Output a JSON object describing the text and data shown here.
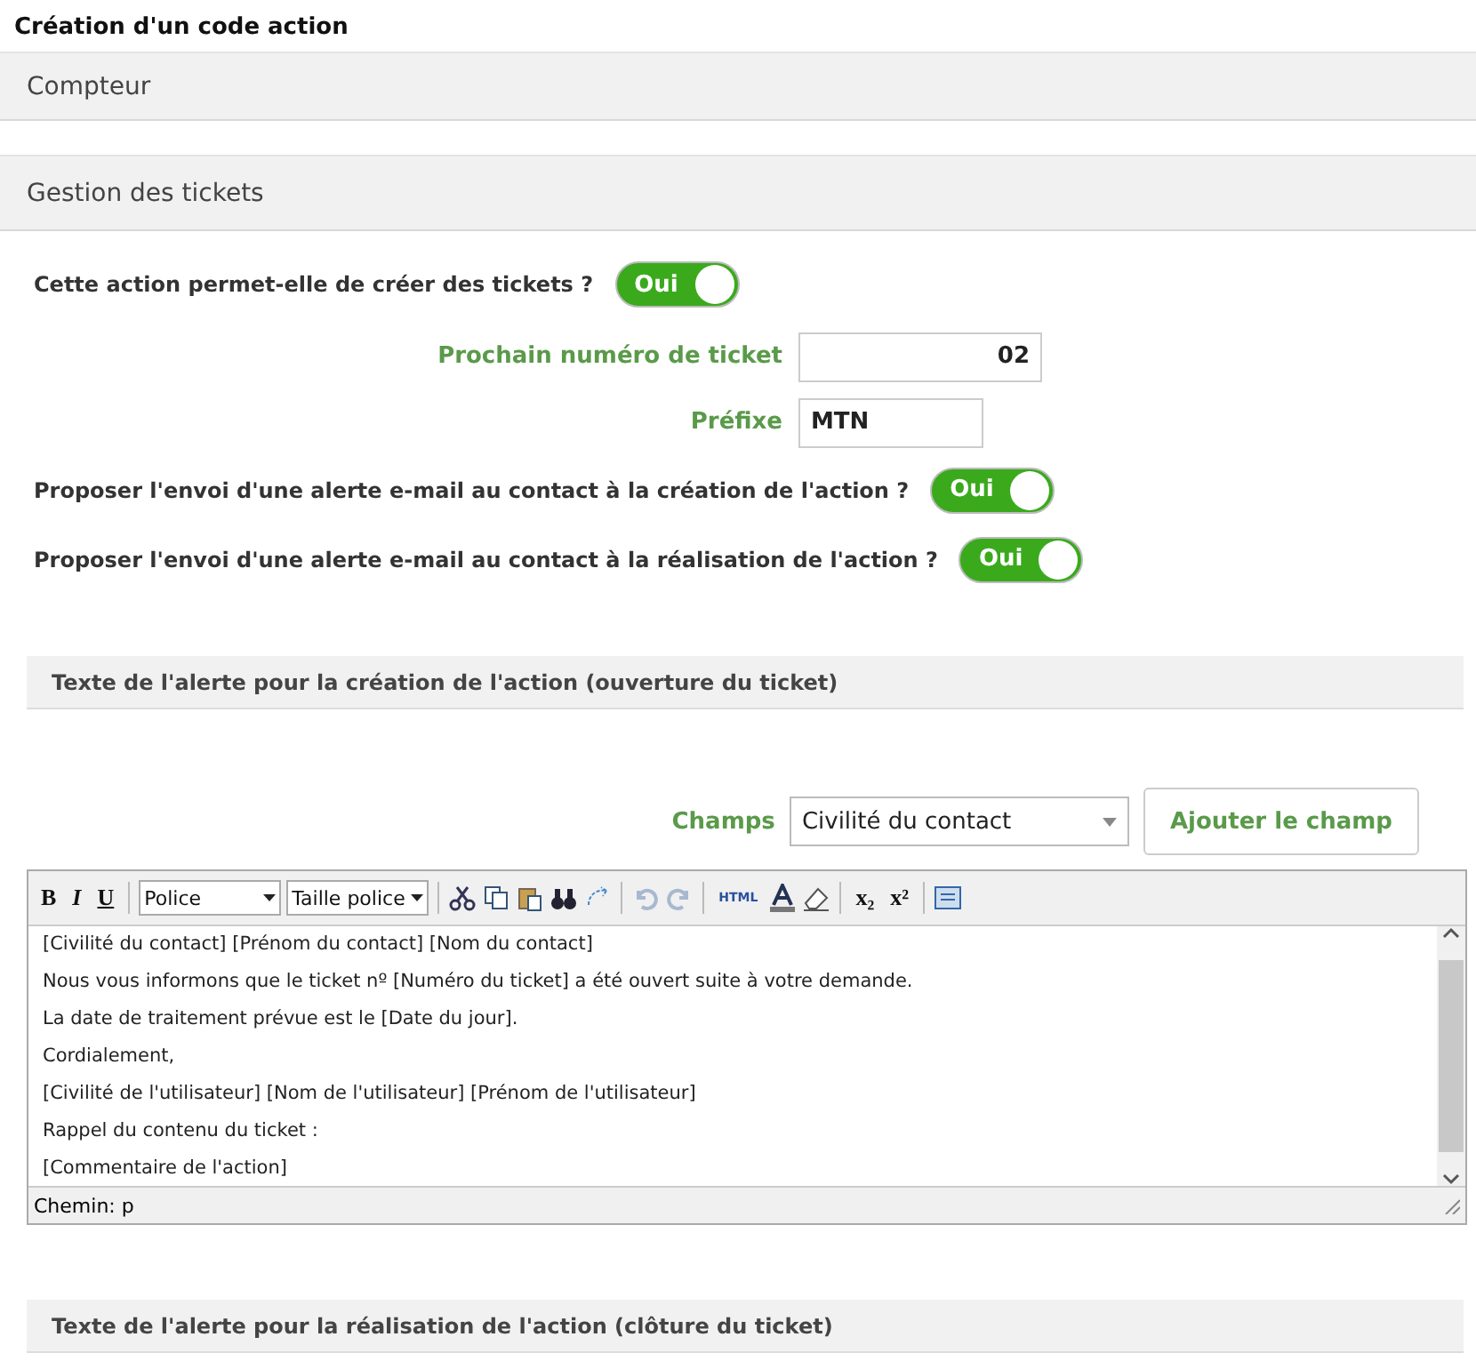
{
  "page_title": "Création d'un code action",
  "sections": [
    {
      "title": "Compteur"
    },
    {
      "title": "Gestion des tickets"
    }
  ],
  "ticket_toggle": {
    "label": "Cette action permet-elle de créer des tickets ?",
    "on": true,
    "text": "Oui"
  },
  "fields": [
    {
      "label": "Prochain numéro de ticket",
      "value": "02"
    },
    {
      "label": "Préfixe",
      "value": "MTN"
    }
  ],
  "alert_toggles": [
    {
      "label": "Proposer l'envoi d'une alerte e-mail au contact à la création de l'action ?",
      "on": true,
      "text": "Oui"
    },
    {
      "label": "Proposer l'envoi d'une alerte e-mail au contact à la réalisation de l'action ?",
      "on": true,
      "text": "Oui"
    }
  ],
  "alert_creation": {
    "title": "Texte de l'alerte pour la création de l'action (ouverture du ticket)",
    "champs_label": "Champs",
    "champs_value": "Civilité du contact",
    "add_button": "Ajouter le champ",
    "toolbar": [
      {
        "kind": "text",
        "label": "B"
      },
      {
        "kind": "text",
        "label": "I"
      },
      {
        "kind": "text",
        "label": "U"
      },
      {
        "kind": "sep"
      },
      {
        "kind": "select",
        "label": "Police"
      },
      {
        "kind": "select",
        "label": "Taille police"
      },
      {
        "kind": "sep"
      },
      {
        "kind": "icon"
      },
      {
        "kind": "icon"
      },
      {
        "kind": "icon"
      },
      {
        "kind": "icon"
      },
      {
        "kind": "icon"
      },
      {
        "kind": "sep"
      },
      {
        "kind": "icon"
      },
      {
        "kind": "icon"
      },
      {
        "kind": "sep"
      },
      {
        "kind": "text",
        "label": "HTML"
      },
      {
        "kind": "icon"
      },
      {
        "kind": "icon"
      },
      {
        "kind": "sep"
      },
      {
        "kind": "text",
        "label": "x₂"
      },
      {
        "kind": "text",
        "label": "x²"
      },
      {
        "kind": "sep"
      },
      {
        "kind": "icon"
      }
    ],
    "lines": [
      "[Civilité du contact] [Prénom du contact] [Nom du contact]",
      "Nous vous informons que le ticket nº [Numéro du ticket] a été ouvert suite à votre demande.",
      "La date de traitement prévue est le [Date du jour].",
      "Cordialement,",
      "[Civilité de l'utilisateur] [Nom de l'utilisateur] [Prénom de l'utilisateur]",
      "Rappel du contenu du ticket :",
      "[Commentaire de l'action]"
    ],
    "path": "Chemin: p"
  },
  "alert_realisation": {
    "title": "Texte de l'alerte pour la réalisation de l'action (clôture du ticket)"
  }
}
